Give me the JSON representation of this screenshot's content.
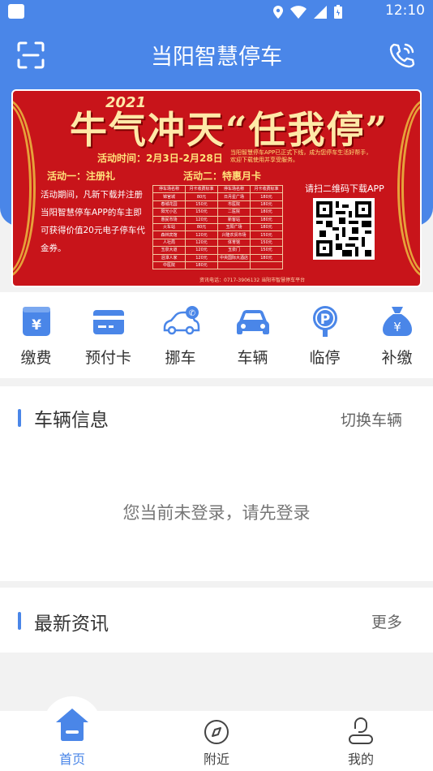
{
  "status_bar": {
    "time": "12:10"
  },
  "header": {
    "title": "当阳智慧停车"
  },
  "banner": {
    "year": "2021",
    "title": "牛气冲天“任我停”",
    "time": "活动时间：2月3日-2月28日",
    "note": "当阳智慧停车APP已正式下线，成为您停车生活好帮手，欢迎下载使用并享受服务。",
    "activity1": "活动一：注册礼",
    "activity2": "活动二：特惠月卡",
    "desc": "活动期间，凡新下载并注册当阳智慧停车APP的车主即可获得价值20元电子停车代金券。",
    "qr_text": "请扫二维码下载APP",
    "footer": "资讯电话：0717-3906132        当阳市智慧停车平台",
    "table": [
      [
        "停车场名称",
        "月卡收费标准",
        "停车场名称",
        "月卡收费标准"
      ],
      [
        "锦官城",
        "80元",
        "日月星广场",
        "180元"
      ],
      [
        "春城花园",
        "150元",
        "市医院",
        "180元"
      ],
      [
        "阳光小区",
        "150元",
        "二医院",
        "180元"
      ],
      [
        "惠民市场",
        "120元",
        "新客站",
        "180元"
      ],
      [
        "火车站",
        "80元",
        "玉阳广场",
        "180元"
      ],
      [
        "森林宾馆",
        "120元",
        "兴隆农贸市场",
        "150元"
      ],
      [
        "人社局",
        "120元",
        "体育馆",
        "150元"
      ],
      [
        "玉泉大道",
        "120元",
        "玉泉门",
        "150元"
      ],
      [
        "沮漳人家",
        "120元",
        "中央国际大酒店",
        "180元"
      ],
      [
        "中医院",
        "180元",
        "",
        ""
      ]
    ]
  },
  "menu": [
    {
      "label": "缴费",
      "icon": "payment-icon",
      "color": "#4a86e8"
    },
    {
      "label": "预付卡",
      "icon": "card-icon",
      "color": "#4a86e8"
    },
    {
      "label": "挪车",
      "icon": "move-car-icon",
      "color": "#4a86e8"
    },
    {
      "label": "车辆",
      "icon": "car-icon",
      "color": "#4a86e8"
    },
    {
      "label": "临停",
      "icon": "parking-icon",
      "color": "#4a86e8"
    },
    {
      "label": "补缴",
      "icon": "money-bag-icon",
      "color": "#4a86e8"
    }
  ],
  "vehicle": {
    "title": "车辆信息",
    "action": "切换车辆",
    "empty": "您当前未登录，请先登录"
  },
  "news": {
    "title": "最新资讯",
    "action": "更多"
  },
  "tabs": [
    {
      "label": "首页",
      "icon": "home-icon"
    },
    {
      "label": "附近",
      "icon": "compass-icon"
    },
    {
      "label": "我的",
      "icon": "profile-icon"
    }
  ],
  "colors": {
    "primary": "#4a86e8",
    "banner_red": "#c8141a"
  }
}
